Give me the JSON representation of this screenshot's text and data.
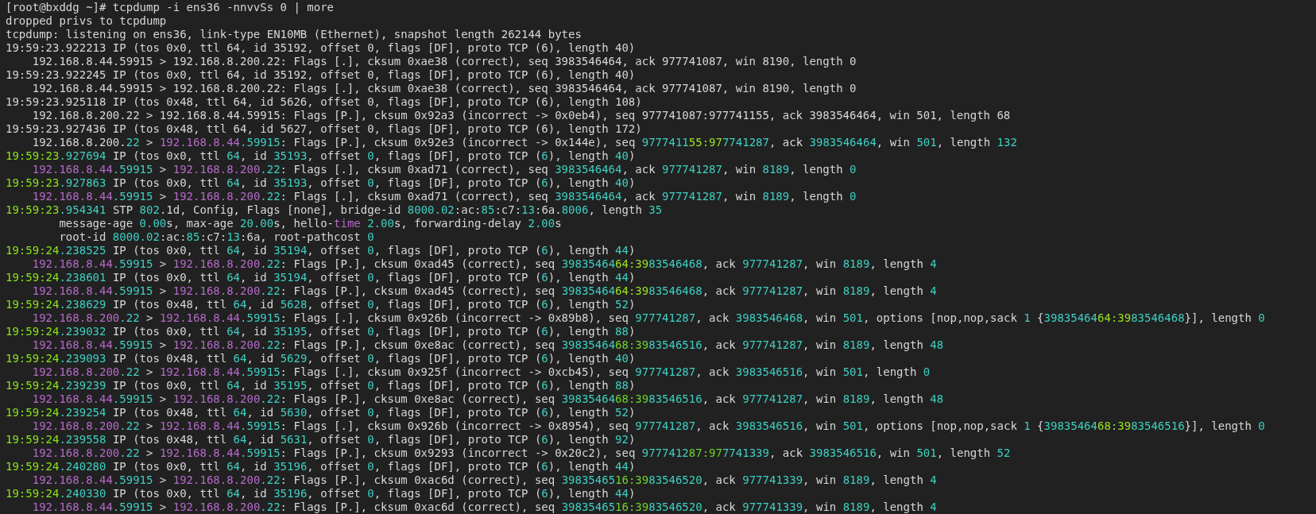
{
  "terminal": {
    "lines": [
      {
        "kind": "command",
        "segments": [
          {
            "text": "[root@bxddg ~]# tcpdump -i ens36 -nnvvSs 0 | more"
          }
        ]
      },
      {
        "kind": "info",
        "segments": [
          {
            "text": "dropped privs to tcpdump"
          }
        ]
      },
      {
        "kind": "info",
        "segments": [
          {
            "text": "tcpdump: listening on ens36, link-type EN10MB (Ethernet), snapshot length 262144 bytes"
          }
        ]
      },
      {
        "kind": "header",
        "segments": [
          {
            "text": "19:59:23.922213 IP (tos 0x0, ttl 64, id 35192, offset 0, flags [DF], proto TCP (6), length 40)"
          }
        ]
      },
      {
        "kind": "packet",
        "segments": [
          {
            "text": "192.168.8.44.59915 > 192.168.8.200.22: Flags [.], cksum 0xae38 (correct), seq 3983546464, ack 977741087, win 8190, length 0"
          }
        ]
      },
      {
        "kind": "header",
        "segments": [
          {
            "text": "19:59:23.922245 IP (tos 0x0, ttl 64, id 35192, offset 0, flags [DF], proto TCP (6), length 40)"
          }
        ]
      },
      {
        "kind": "packet",
        "segments": [
          {
            "text": "192.168.8.44.59915 > 192.168.8.200.22: Flags [.], cksum 0xae38 (correct), seq 3983546464, ack 977741087, win 8190, length 0"
          }
        ]
      },
      {
        "kind": "header",
        "segments": [
          {
            "text": "19:59:23.925118 IP (tos 0x48, ttl 64, id 5626, offset 0, flags [DF], proto TCP (6), length 108)"
          }
        ]
      },
      {
        "kind": "packet",
        "segments": [
          {
            "text": "192.168.8.200.22 > 192.168.8.44.59915: Flags [P.], cksum 0x92a3 (incorrect -> 0x0eb4), seq 977741087:977741155, ack 3983546464, win 501, length 68"
          }
        ]
      },
      {
        "kind": "header",
        "segments": [
          {
            "text": "19:59:23.927436 IP (tos 0x48, ttl 64, id 5627, offset 0, flags [DF], proto TCP (6), length 172)"
          }
        ]
      },
      {
        "kind": "packet",
        "segments": [
          {
            "text": "192.168.8.200."
          },
          {
            "text": "22",
            "color": "#3ecfc2"
          },
          {
            "text": " > "
          },
          {
            "text": "192.168.8.44",
            "color": "#b46ac8"
          },
          {
            "text": ".59915",
            "color": "#3ecfc2"
          },
          {
            "text": ": Flags [P.], cksum 0x92e3 (incorrect -> 0x144e), seq "
          },
          {
            "text": "9777411",
            "color": "#3ecfc2"
          },
          {
            "text": "55:97",
            "color": "#9be21e"
          },
          {
            "text": "7741287",
            "color": "#3ecfc2"
          },
          {
            "text": ", ack "
          },
          {
            "text": "3983546464",
            "color": "#3ecfc2"
          },
          {
            "text": ", win "
          },
          {
            "text": "501",
            "color": "#3ecfc2"
          },
          {
            "text": ", length "
          },
          {
            "text": "132",
            "color": "#3ecfc2"
          }
        ]
      },
      {
        "kind": "header",
        "segments": [
          {
            "text": "19:59:23",
            "color": "#8ae21c"
          },
          {
            "text": ".927694",
            "color": "#3ecfc2"
          },
          {
            "text": " IP (tos 0x0, ttl "
          },
          {
            "text": "64",
            "color": "#3ecfc2"
          },
          {
            "text": ", id "
          },
          {
            "text": "35193",
            "color": "#3ecfc2"
          },
          {
            "text": ", offset "
          },
          {
            "text": "0",
            "color": "#3ecfc2"
          },
          {
            "text": ", flags [DF], proto TCP ("
          },
          {
            "text": "6",
            "color": "#3ecfc2"
          },
          {
            "text": "), length "
          },
          {
            "text": "40",
            "color": "#3ecfc2"
          },
          {
            "text": ")"
          }
        ]
      },
      {
        "kind": "packet",
        "segments": [
          {
            "text": "192.168.8.44",
            "color": "#b46ac8"
          },
          {
            "text": ".59915",
            "color": "#3ecfc2"
          },
          {
            "text": " > "
          },
          {
            "text": "192.168.8.200",
            "color": "#b46ac8"
          },
          {
            "text": ".22",
            "color": "#3ecfc2"
          },
          {
            "text": ": Flags [.], cksum 0xad71 (correct), seq "
          },
          {
            "text": "3983546464",
            "color": "#3ecfc2"
          },
          {
            "text": ", ack "
          },
          {
            "text": "977741287",
            "color": "#3ecfc2"
          },
          {
            "text": ", win "
          },
          {
            "text": "8189",
            "color": "#3ecfc2"
          },
          {
            "text": ", length "
          },
          {
            "text": "0",
            "color": "#3ecfc2"
          }
        ]
      },
      {
        "kind": "header",
        "segments": [
          {
            "text": "19:59:23",
            "color": "#8ae21c"
          },
          {
            "text": ".927863",
            "color": "#3ecfc2"
          },
          {
            "text": " IP (tos 0x0, ttl "
          },
          {
            "text": "64",
            "color": "#3ecfc2"
          },
          {
            "text": ", id "
          },
          {
            "text": "35193",
            "color": "#3ecfc2"
          },
          {
            "text": ", offset "
          },
          {
            "text": "0",
            "color": "#3ecfc2"
          },
          {
            "text": ", flags [DF], proto TCP ("
          },
          {
            "text": "6",
            "color": "#3ecfc2"
          },
          {
            "text": "), length "
          },
          {
            "text": "40",
            "color": "#3ecfc2"
          },
          {
            "text": ")"
          }
        ]
      },
      {
        "kind": "packet",
        "segments": [
          {
            "text": "192.168.8.44",
            "color": "#b46ac8"
          },
          {
            "text": ".59915",
            "color": "#3ecfc2"
          },
          {
            "text": " > "
          },
          {
            "text": "192.168.8.200",
            "color": "#b46ac8"
          },
          {
            "text": ".22",
            "color": "#3ecfc2"
          },
          {
            "text": ": Flags [.], cksum 0xad71 (correct), seq "
          },
          {
            "text": "3983546464",
            "color": "#3ecfc2"
          },
          {
            "text": ", ack "
          },
          {
            "text": "977741287",
            "color": "#3ecfc2"
          },
          {
            "text": ", win "
          },
          {
            "text": "8189",
            "color": "#3ecfc2"
          },
          {
            "text": ", length "
          },
          {
            "text": "0",
            "color": "#3ecfc2"
          }
        ]
      },
      {
        "kind": "header",
        "segments": [
          {
            "text": "19:59:23",
            "color": "#8ae21c"
          },
          {
            "text": ".954341",
            "color": "#3ecfc2"
          },
          {
            "text": " STP "
          },
          {
            "text": "802",
            "color": "#3ecfc2"
          },
          {
            "text": ".1d, Config, Flags [none], bridge-id "
          },
          {
            "text": "8000.02",
            "color": "#3ecfc2"
          },
          {
            "text": ":ac:"
          },
          {
            "text": "85",
            "color": "#3ecfc2"
          },
          {
            "text": ":c7:"
          },
          {
            "text": "13",
            "color": "#3ecfc2"
          },
          {
            "text": ":6a."
          },
          {
            "text": "8006",
            "color": "#3ecfc2"
          },
          {
            "text": ", length "
          },
          {
            "text": "35",
            "color": "#3ecfc2"
          }
        ]
      },
      {
        "kind": "detail",
        "segments": [
          {
            "text": "message-age "
          },
          {
            "text": "0.00",
            "color": "#3ecfc2"
          },
          {
            "text": "s, max-age "
          },
          {
            "text": "20.00",
            "color": "#3ecfc2"
          },
          {
            "text": "s, hello-"
          },
          {
            "text": "time",
            "color": "#b46ac8"
          },
          {
            "text": " 2.00",
            "color": "#3ecfc2"
          },
          {
            "text": "s, forwarding-delay "
          },
          {
            "text": "2.00",
            "color": "#3ecfc2"
          },
          {
            "text": "s"
          }
        ]
      },
      {
        "kind": "detail",
        "segments": [
          {
            "text": "root-id "
          },
          {
            "text": "8000.02",
            "color": "#3ecfc2"
          },
          {
            "text": ":ac:"
          },
          {
            "text": "85",
            "color": "#3ecfc2"
          },
          {
            "text": ":c7:"
          },
          {
            "text": "13",
            "color": "#3ecfc2"
          },
          {
            "text": ":6a, root-pathcost "
          },
          {
            "text": "0",
            "color": "#3ecfc2"
          }
        ]
      },
      {
        "kind": "header",
        "segments": [
          {
            "text": "19:59:24",
            "color": "#8ae21c"
          },
          {
            "text": ".238525",
            "color": "#3ecfc2"
          },
          {
            "text": " IP (tos 0x0, ttl "
          },
          {
            "text": "64",
            "color": "#3ecfc2"
          },
          {
            "text": ", id "
          },
          {
            "text": "35194",
            "color": "#3ecfc2"
          },
          {
            "text": ", offset "
          },
          {
            "text": "0",
            "color": "#3ecfc2"
          },
          {
            "text": ", flags [DF], proto TCP ("
          },
          {
            "text": "6",
            "color": "#3ecfc2"
          },
          {
            "text": "), length "
          },
          {
            "text": "44",
            "color": "#3ecfc2"
          },
          {
            "text": ")"
          }
        ]
      },
      {
        "kind": "packet",
        "segments": [
          {
            "text": "192.168.8.44",
            "color": "#b46ac8"
          },
          {
            "text": ".59915",
            "color": "#3ecfc2"
          },
          {
            "text": " > "
          },
          {
            "text": "192.168.8.200",
            "color": "#b46ac8"
          },
          {
            "text": ".22",
            "color": "#3ecfc2"
          },
          {
            "text": ": Flags [P.], cksum 0xad45 (correct), seq "
          },
          {
            "text": "39835464",
            "color": "#3ecfc2"
          },
          {
            "text": "64:39",
            "color": "#9be21e"
          },
          {
            "text": "83546468",
            "color": "#3ecfc2"
          },
          {
            "text": ", ack "
          },
          {
            "text": "977741287",
            "color": "#3ecfc2"
          },
          {
            "text": ", win "
          },
          {
            "text": "8189",
            "color": "#3ecfc2"
          },
          {
            "text": ", length "
          },
          {
            "text": "4",
            "color": "#3ecfc2"
          }
        ]
      },
      {
        "kind": "header",
        "segments": [
          {
            "text": "19:59:24",
            "color": "#8ae21c"
          },
          {
            "text": ".238601",
            "color": "#3ecfc2"
          },
          {
            "text": " IP (tos 0x0, ttl "
          },
          {
            "text": "64",
            "color": "#3ecfc2"
          },
          {
            "text": ", id "
          },
          {
            "text": "35194",
            "color": "#3ecfc2"
          },
          {
            "text": ", offset "
          },
          {
            "text": "0",
            "color": "#3ecfc2"
          },
          {
            "text": ", flags [DF], proto TCP ("
          },
          {
            "text": "6",
            "color": "#3ecfc2"
          },
          {
            "text": "), length "
          },
          {
            "text": "44",
            "color": "#3ecfc2"
          },
          {
            "text": ")"
          }
        ]
      },
      {
        "kind": "packet",
        "segments": [
          {
            "text": "192.168.8.44",
            "color": "#b46ac8"
          },
          {
            "text": ".59915",
            "color": "#3ecfc2"
          },
          {
            "text": " > "
          },
          {
            "text": "192.168.8.200",
            "color": "#b46ac8"
          },
          {
            "text": ".22",
            "color": "#3ecfc2"
          },
          {
            "text": ": Flags [P.], cksum 0xad45 (correct), seq "
          },
          {
            "text": "39835464",
            "color": "#3ecfc2"
          },
          {
            "text": "64:39",
            "color": "#9be21e"
          },
          {
            "text": "83546468",
            "color": "#3ecfc2"
          },
          {
            "text": ", ack "
          },
          {
            "text": "977741287",
            "color": "#3ecfc2"
          },
          {
            "text": ", win "
          },
          {
            "text": "8189",
            "color": "#3ecfc2"
          },
          {
            "text": ", length "
          },
          {
            "text": "4",
            "color": "#3ecfc2"
          }
        ]
      },
      {
        "kind": "header",
        "segments": [
          {
            "text": "19:59:24",
            "color": "#8ae21c"
          },
          {
            "text": ".238629",
            "color": "#3ecfc2"
          },
          {
            "text": " IP (tos 0x48, ttl "
          },
          {
            "text": "64",
            "color": "#3ecfc2"
          },
          {
            "text": ", id "
          },
          {
            "text": "5628",
            "color": "#3ecfc2"
          },
          {
            "text": ", offset "
          },
          {
            "text": "0",
            "color": "#3ecfc2"
          },
          {
            "text": ", flags [DF], proto TCP ("
          },
          {
            "text": "6",
            "color": "#3ecfc2"
          },
          {
            "text": "), length "
          },
          {
            "text": "52",
            "color": "#3ecfc2"
          },
          {
            "text": ")"
          }
        ]
      },
      {
        "kind": "packet",
        "segments": [
          {
            "text": "192.168.8.200",
            "color": "#b46ac8"
          },
          {
            "text": ".22",
            "color": "#3ecfc2"
          },
          {
            "text": " > "
          },
          {
            "text": "192.168.8.44",
            "color": "#b46ac8"
          },
          {
            "text": ".59915",
            "color": "#3ecfc2"
          },
          {
            "text": ": Flags [.], cksum 0x926b (incorrect -> 0x89b8), seq "
          },
          {
            "text": "977741287",
            "color": "#3ecfc2"
          },
          {
            "text": ", ack "
          },
          {
            "text": "3983546468",
            "color": "#3ecfc2"
          },
          {
            "text": ", win "
          },
          {
            "text": "501",
            "color": "#3ecfc2"
          },
          {
            "text": ", options [nop,nop,sack "
          },
          {
            "text": "1",
            "color": "#3ecfc2"
          },
          {
            "text": " {"
          },
          {
            "text": "39835464",
            "color": "#3ecfc2"
          },
          {
            "text": "64:39",
            "color": "#9be21e"
          },
          {
            "text": "83546468",
            "color": "#3ecfc2"
          },
          {
            "text": "}], length "
          },
          {
            "text": "0",
            "color": "#3ecfc2"
          }
        ]
      },
      {
        "kind": "header",
        "segments": [
          {
            "text": "19:59:24",
            "color": "#8ae21c"
          },
          {
            "text": ".239032",
            "color": "#3ecfc2"
          },
          {
            "text": " IP (tos 0x0, ttl "
          },
          {
            "text": "64",
            "color": "#3ecfc2"
          },
          {
            "text": ", id "
          },
          {
            "text": "35195",
            "color": "#3ecfc2"
          },
          {
            "text": ", offset "
          },
          {
            "text": "0",
            "color": "#3ecfc2"
          },
          {
            "text": ", flags [DF], proto TCP ("
          },
          {
            "text": "6",
            "color": "#3ecfc2"
          },
          {
            "text": "), length "
          },
          {
            "text": "88",
            "color": "#3ecfc2"
          },
          {
            "text": ")"
          }
        ]
      },
      {
        "kind": "packet",
        "segments": [
          {
            "text": "192.168.8.44",
            "color": "#b46ac8"
          },
          {
            "text": ".59915",
            "color": "#3ecfc2"
          },
          {
            "text": " > "
          },
          {
            "text": "192.168.8.200",
            "color": "#b46ac8"
          },
          {
            "text": ".22",
            "color": "#3ecfc2"
          },
          {
            "text": ": Flags [P.], cksum 0xe8ac (correct), seq "
          },
          {
            "text": "39835464",
            "color": "#3ecfc2"
          },
          {
            "text": "68:39",
            "color": "#6fd42a"
          },
          {
            "text": "83546516",
            "color": "#3ecfc2"
          },
          {
            "text": ", ack "
          },
          {
            "text": "977741287",
            "color": "#3ecfc2"
          },
          {
            "text": ", win "
          },
          {
            "text": "8189",
            "color": "#3ecfc2"
          },
          {
            "text": ", length "
          },
          {
            "text": "48",
            "color": "#3ecfc2"
          }
        ]
      },
      {
        "kind": "header",
        "segments": [
          {
            "text": "19:59:24",
            "color": "#8ae21c"
          },
          {
            "text": ".239093",
            "color": "#3ecfc2"
          },
          {
            "text": " IP (tos 0x48, ttl "
          },
          {
            "text": "64",
            "color": "#3ecfc2"
          },
          {
            "text": ", id "
          },
          {
            "text": "5629",
            "color": "#3ecfc2"
          },
          {
            "text": ", offset "
          },
          {
            "text": "0",
            "color": "#3ecfc2"
          },
          {
            "text": ", flags [DF], proto TCP ("
          },
          {
            "text": "6",
            "color": "#3ecfc2"
          },
          {
            "text": "), length "
          },
          {
            "text": "40",
            "color": "#3ecfc2"
          },
          {
            "text": ")"
          }
        ]
      },
      {
        "kind": "packet",
        "segments": [
          {
            "text": "192.168.8.200",
            "color": "#b46ac8"
          },
          {
            "text": ".22",
            "color": "#3ecfc2"
          },
          {
            "text": " > "
          },
          {
            "text": "192.168.8.44",
            "color": "#b46ac8"
          },
          {
            "text": ".59915",
            "color": "#3ecfc2"
          },
          {
            "text": ": Flags [.], cksum 0x925f (incorrect -> 0xcb45), seq "
          },
          {
            "text": "977741287",
            "color": "#3ecfc2"
          },
          {
            "text": ", ack "
          },
          {
            "text": "3983546516",
            "color": "#3ecfc2"
          },
          {
            "text": ", win "
          },
          {
            "text": "501",
            "color": "#3ecfc2"
          },
          {
            "text": ", length "
          },
          {
            "text": "0",
            "color": "#3ecfc2"
          }
        ]
      },
      {
        "kind": "header",
        "segments": [
          {
            "text": "19:59:24",
            "color": "#8ae21c"
          },
          {
            "text": ".239239",
            "color": "#3ecfc2"
          },
          {
            "text": " IP (tos 0x0, ttl "
          },
          {
            "text": "64",
            "color": "#3ecfc2"
          },
          {
            "text": ", id "
          },
          {
            "text": "35195",
            "color": "#3ecfc2"
          },
          {
            "text": ", offset "
          },
          {
            "text": "0",
            "color": "#3ecfc2"
          },
          {
            "text": ", flags [DF], proto TCP ("
          },
          {
            "text": "6",
            "color": "#3ecfc2"
          },
          {
            "text": "), length "
          },
          {
            "text": "88",
            "color": "#3ecfc2"
          },
          {
            "text": ")"
          }
        ]
      },
      {
        "kind": "packet",
        "segments": [
          {
            "text": "192.168.8.44",
            "color": "#b46ac8"
          },
          {
            "text": ".59915",
            "color": "#3ecfc2"
          },
          {
            "text": " > "
          },
          {
            "text": "192.168.8.200",
            "color": "#b46ac8"
          },
          {
            "text": ".22",
            "color": "#3ecfc2"
          },
          {
            "text": ": Flags [P.], cksum 0xe8ac (correct), seq "
          },
          {
            "text": "39835464",
            "color": "#3ecfc2"
          },
          {
            "text": "68:39",
            "color": "#6fd42a"
          },
          {
            "text": "83546516",
            "color": "#3ecfc2"
          },
          {
            "text": ", ack "
          },
          {
            "text": "977741287",
            "color": "#3ecfc2"
          },
          {
            "text": ", win "
          },
          {
            "text": "8189",
            "color": "#3ecfc2"
          },
          {
            "text": ", length "
          },
          {
            "text": "48",
            "color": "#3ecfc2"
          }
        ]
      },
      {
        "kind": "header",
        "segments": [
          {
            "text": "19:59:24",
            "color": "#8ae21c"
          },
          {
            "text": ".239254",
            "color": "#3ecfc2"
          },
          {
            "text": " IP (tos 0x48, ttl "
          },
          {
            "text": "64",
            "color": "#3ecfc2"
          },
          {
            "text": ", id "
          },
          {
            "text": "5630",
            "color": "#3ecfc2"
          },
          {
            "text": ", offset "
          },
          {
            "text": "0",
            "color": "#3ecfc2"
          },
          {
            "text": ", flags [DF], proto TCP ("
          },
          {
            "text": "6",
            "color": "#3ecfc2"
          },
          {
            "text": "), length "
          },
          {
            "text": "52",
            "color": "#3ecfc2"
          },
          {
            "text": ")"
          }
        ]
      },
      {
        "kind": "packet",
        "segments": [
          {
            "text": "192.168.8.200",
            "color": "#b46ac8"
          },
          {
            "text": ".22",
            "color": "#3ecfc2"
          },
          {
            "text": " > "
          },
          {
            "text": "192.168.8.44",
            "color": "#b46ac8"
          },
          {
            "text": ".59915",
            "color": "#3ecfc2"
          },
          {
            "text": ": Flags [.], cksum 0x926b (incorrect -> 0x8954), seq "
          },
          {
            "text": "977741287",
            "color": "#3ecfc2"
          },
          {
            "text": ", ack "
          },
          {
            "text": "3983546516",
            "color": "#3ecfc2"
          },
          {
            "text": ", win "
          },
          {
            "text": "501",
            "color": "#3ecfc2"
          },
          {
            "text": ", options [nop,nop,sack "
          },
          {
            "text": "1",
            "color": "#3ecfc2"
          },
          {
            "text": " {"
          },
          {
            "text": "39835464",
            "color": "#3ecfc2"
          },
          {
            "text": "68:39",
            "color": "#9be21e"
          },
          {
            "text": "83546516",
            "color": "#3ecfc2"
          },
          {
            "text": "}], length "
          },
          {
            "text": "0",
            "color": "#3ecfc2"
          }
        ]
      },
      {
        "kind": "header",
        "segments": [
          {
            "text": "19:59:24",
            "color": "#8ae21c"
          },
          {
            "text": ".239558",
            "color": "#3ecfc2"
          },
          {
            "text": " IP (tos 0x48, ttl "
          },
          {
            "text": "64",
            "color": "#3ecfc2"
          },
          {
            "text": ", id "
          },
          {
            "text": "5631",
            "color": "#3ecfc2"
          },
          {
            "text": ", offset "
          },
          {
            "text": "0",
            "color": "#3ecfc2"
          },
          {
            "text": ", flags [DF], proto TCP ("
          },
          {
            "text": "6",
            "color": "#3ecfc2"
          },
          {
            "text": "), length "
          },
          {
            "text": "92",
            "color": "#3ecfc2"
          },
          {
            "text": ")"
          }
        ]
      },
      {
        "kind": "packet",
        "segments": [
          {
            "text": "192.168.8.200",
            "color": "#b46ac8"
          },
          {
            "text": ".22",
            "color": "#3ecfc2"
          },
          {
            "text": " > "
          },
          {
            "text": "192.168.8.44",
            "color": "#b46ac8"
          },
          {
            "text": ".59915",
            "color": "#3ecfc2"
          },
          {
            "text": ": Flags [P.], cksum 0x9293 (incorrect -> 0x20c2), seq "
          },
          {
            "text": "9777412",
            "color": "#3ecfc2"
          },
          {
            "text": "87:97",
            "color": "#6fd42a"
          },
          {
            "text": "7741339",
            "color": "#3ecfc2"
          },
          {
            "text": ", ack "
          },
          {
            "text": "3983546516",
            "color": "#3ecfc2"
          },
          {
            "text": ", win "
          },
          {
            "text": "501",
            "color": "#3ecfc2"
          },
          {
            "text": ", length "
          },
          {
            "text": "52",
            "color": "#3ecfc2"
          }
        ]
      },
      {
        "kind": "header",
        "segments": [
          {
            "text": "19:59:24",
            "color": "#8ae21c"
          },
          {
            "text": ".240280",
            "color": "#3ecfc2"
          },
          {
            "text": " IP (tos 0x0, ttl "
          },
          {
            "text": "64",
            "color": "#3ecfc2"
          },
          {
            "text": ", id "
          },
          {
            "text": "35196",
            "color": "#3ecfc2"
          },
          {
            "text": ", offset "
          },
          {
            "text": "0",
            "color": "#3ecfc2"
          },
          {
            "text": ", flags [DF], proto TCP ("
          },
          {
            "text": "6",
            "color": "#3ecfc2"
          },
          {
            "text": "), length "
          },
          {
            "text": "44",
            "color": "#3ecfc2"
          },
          {
            "text": ")"
          }
        ]
      },
      {
        "kind": "packet",
        "segments": [
          {
            "text": "192.168.8.44",
            "color": "#b46ac8"
          },
          {
            "text": ".59915",
            "color": "#3ecfc2"
          },
          {
            "text": " > "
          },
          {
            "text": "192.168.8.200",
            "color": "#b46ac8"
          },
          {
            "text": ".22",
            "color": "#3ecfc2"
          },
          {
            "text": ": Flags [P.], cksum 0xac6d (correct), seq "
          },
          {
            "text": "39835465",
            "color": "#3ecfc2"
          },
          {
            "text": "16:39",
            "color": "#6fd42a"
          },
          {
            "text": "83546520",
            "color": "#3ecfc2"
          },
          {
            "text": ", ack "
          },
          {
            "text": "977741339",
            "color": "#3ecfc2"
          },
          {
            "text": ", win "
          },
          {
            "text": "8189",
            "color": "#3ecfc2"
          },
          {
            "text": ", length "
          },
          {
            "text": "4",
            "color": "#3ecfc2"
          }
        ]
      },
      {
        "kind": "header",
        "segments": [
          {
            "text": "19:59:24",
            "color": "#8ae21c"
          },
          {
            "text": ".240330",
            "color": "#3ecfc2"
          },
          {
            "text": " IP (tos 0x0, ttl "
          },
          {
            "text": "64",
            "color": "#3ecfc2"
          },
          {
            "text": ", id "
          },
          {
            "text": "35196",
            "color": "#3ecfc2"
          },
          {
            "text": ", offset "
          },
          {
            "text": "0",
            "color": "#3ecfc2"
          },
          {
            "text": ", flags [DF], proto TCP ("
          },
          {
            "text": "6",
            "color": "#3ecfc2"
          },
          {
            "text": "), length "
          },
          {
            "text": "44",
            "color": "#3ecfc2"
          },
          {
            "text": ")"
          }
        ]
      },
      {
        "kind": "packet",
        "segments": [
          {
            "text": "192.168.8.44",
            "color": "#b46ac8"
          },
          {
            "text": ".59915",
            "color": "#3ecfc2"
          },
          {
            "text": " > "
          },
          {
            "text": "192.168.8.200",
            "color": "#b46ac8"
          },
          {
            "text": ".22",
            "color": "#3ecfc2"
          },
          {
            "text": ": Flags [P.], cksum 0xac6d (correct), seq "
          },
          {
            "text": "39835465",
            "color": "#3ecfc2"
          },
          {
            "text": "16:39",
            "color": "#6fd42a"
          },
          {
            "text": "83546520",
            "color": "#3ecfc2"
          },
          {
            "text": ", ack "
          },
          {
            "text": "977741339",
            "color": "#3ecfc2"
          },
          {
            "text": ", win "
          },
          {
            "text": "8189",
            "color": "#3ecfc2"
          },
          {
            "text": ", length "
          },
          {
            "text": "4",
            "color": "#3ecfc2"
          }
        ]
      }
    ]
  }
}
